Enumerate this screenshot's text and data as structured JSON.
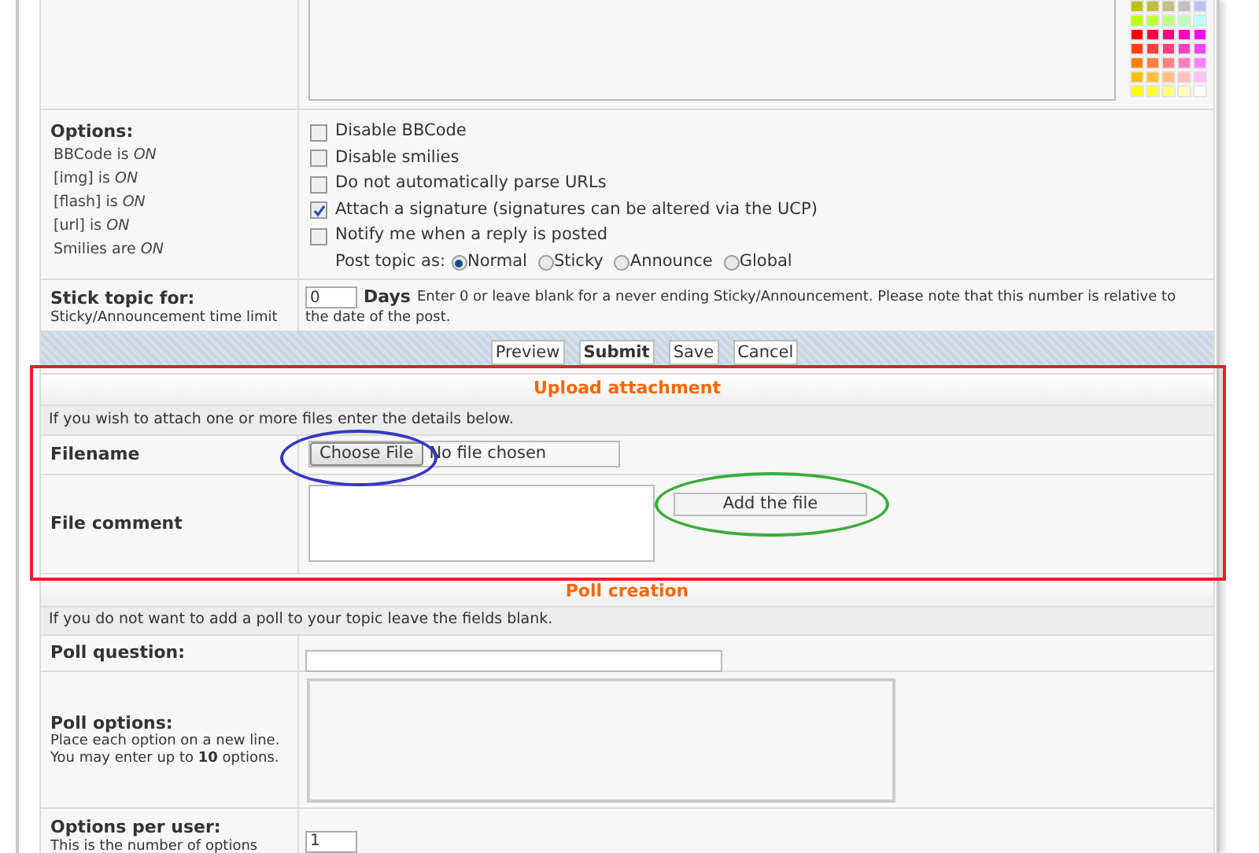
{
  "message_area": {
    "color_palette": [
      {
        "color": "#c0c000"
      },
      {
        "color": "#c0c040"
      },
      {
        "color": "#c0c080"
      },
      {
        "color": "#c0c0c0"
      },
      {
        "color": "#c0c0ff"
      },
      {
        "color": "#c0ff00"
      },
      {
        "color": "#c0ff40"
      },
      {
        "color": "#c0ff80"
      },
      {
        "color": "#c0ffc0"
      },
      {
        "color": "#c0ffff"
      },
      {
        "color": "#ff0000"
      },
      {
        "color": "#ff0040"
      },
      {
        "color": "#ff0080"
      },
      {
        "color": "#ff00c0"
      },
      {
        "color": "#ff00ff"
      },
      {
        "color": "#ff4000"
      },
      {
        "color": "#ff4040"
      },
      {
        "color": "#ff4080"
      },
      {
        "color": "#ff40c0"
      },
      {
        "color": "#ff40ff"
      },
      {
        "color": "#ff8000"
      },
      {
        "color": "#ff8040"
      },
      {
        "color": "#ff8080"
      },
      {
        "color": "#ff80c0"
      },
      {
        "color": "#ff80ff"
      },
      {
        "color": "#ffc000"
      },
      {
        "color": "#ffc040"
      },
      {
        "color": "#ffc080"
      },
      {
        "color": "#ffc0c0"
      },
      {
        "color": "#ffc0ff"
      },
      {
        "color": "#ffff00"
      },
      {
        "color": "#ffff40"
      },
      {
        "color": "#ffff80"
      },
      {
        "color": "#ffffc0"
      },
      {
        "color": "#ffffff"
      }
    ]
  },
  "options": {
    "label": "Options:",
    "statuses": [
      "BBCode is *ON*",
      "[img] is *ON*",
      "[flash] is *ON*",
      "[url] is *ON*",
      "Smilies are *ON*"
    ],
    "checkboxes": [
      {
        "label": "Disable BBCode",
        "checked": false
      },
      {
        "label": "Disable smilies",
        "checked": false
      },
      {
        "label": "Do not automatically parse URLs",
        "checked": false
      },
      {
        "label": "Attach a signature (signatures can be altered via the UCP)",
        "checked": true
      },
      {
        "label": "Notify me when a reply is posted",
        "checked": false
      }
    ],
    "post_topic_as": {
      "label": "Post topic as:",
      "choices": [
        {
          "label": "Normal",
          "selected": true
        },
        {
          "label": "Sticky",
          "selected": false
        },
        {
          "label": "Announce",
          "selected": false
        },
        {
          "label": "Global",
          "selected": false
        }
      ]
    }
  },
  "stick_topic": {
    "label": "Stick topic for:",
    "hint": "Sticky/Announcement time limit",
    "value": "0",
    "unit": "Days",
    "note_lines": [
      "Enter 0 or leave blank for a never ending Sticky/Announcement. Please note that this number is relative to",
      "the date of the post."
    ]
  },
  "buttons": [
    {
      "label": "Preview",
      "primary": false
    },
    {
      "label": "Submit",
      "primary": true
    },
    {
      "label": "Save",
      "primary": false
    },
    {
      "label": "Cancel",
      "primary": false
    }
  ],
  "upload": {
    "title": "Upload attachment",
    "info": "If you wish to attach one or more files enter the details below.",
    "filename_label": "Filename",
    "choose_button": "Choose File",
    "file_status": "No file chosen",
    "comment_label": "File comment",
    "add_button": "Add the file"
  },
  "poll": {
    "title": "Poll creation",
    "info": "If you do not want to add a poll to your topic leave the fields blank.",
    "question_label": "Poll question:",
    "options_label": "Poll options:",
    "options_hint": [
      "Place each option on a new line.",
      "You may enter up to **10** options."
    ],
    "per_user_label": "Options per user:",
    "per_user_hint": "This is the number of options",
    "per_user_value": "1"
  }
}
